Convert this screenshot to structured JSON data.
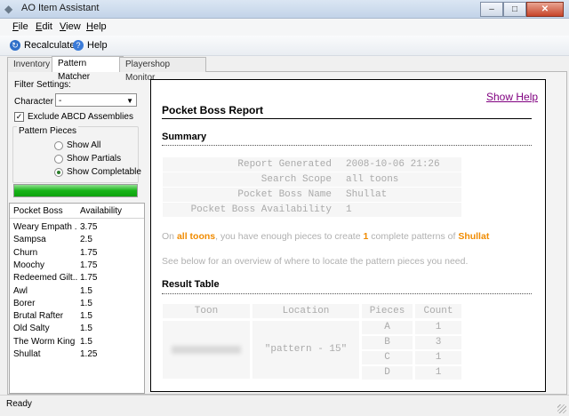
{
  "window": {
    "title": "AO Item Assistant",
    "controls": [
      "–",
      "□",
      "✕"
    ]
  },
  "menu": [
    {
      "key": "F",
      "rest": "ile"
    },
    {
      "key": "E",
      "rest": "dit"
    },
    {
      "key": "V",
      "rest": "iew"
    },
    {
      "key": "H",
      "rest": "elp"
    }
  ],
  "toolbar": {
    "recalculate_label": "Recalculate",
    "help_label": "Help"
  },
  "tabs": [
    {
      "label": "Inventory"
    },
    {
      "label": "Pattern Matcher"
    },
    {
      "label": "Playershop Monitor"
    }
  ],
  "filter": {
    "settings_label": "Filter Settings:",
    "character_label": "Character",
    "character_value": "-",
    "exclude_label": "Exclude ABCD Assemblies",
    "exclude_checked": true,
    "group_label": "Pattern Pieces",
    "radios": [
      {
        "label": "Show All",
        "selected": false
      },
      {
        "label": "Show Partials",
        "selected": false
      },
      {
        "label": "Show Completable",
        "selected": true
      }
    ],
    "progress_fraction": 1.0
  },
  "boss_list": {
    "headers": [
      "Pocket Boss",
      "Availability"
    ],
    "rows": [
      {
        "name": "Weary Empath ...",
        "avail": "3.75"
      },
      {
        "name": "Sampsa",
        "avail": "2.5"
      },
      {
        "name": "Churn",
        "avail": "1.75"
      },
      {
        "name": "Moochy",
        "avail": "1.75"
      },
      {
        "name": "Redeemed Gilt...",
        "avail": "1.75"
      },
      {
        "name": "Awl",
        "avail": "1.5"
      },
      {
        "name": "Borer",
        "avail": "1.5"
      },
      {
        "name": "Brutal Rafter",
        "avail": "1.5"
      },
      {
        "name": "Old Salty",
        "avail": "1.5"
      },
      {
        "name": "The Worm King",
        "avail": "1.5"
      },
      {
        "name": "Shullat",
        "avail": "1.25"
      }
    ]
  },
  "report": {
    "show_help": "Show Help",
    "title": "Pocket Boss Report",
    "summary_title": "Summary",
    "summary": [
      {
        "k": "Report Generated",
        "v": "2008-10-06 21:26"
      },
      {
        "k": "Search Scope",
        "v": "all toons"
      },
      {
        "k": "Pocket Boss Name",
        "v": "Shullat"
      },
      {
        "k": "Pocket Boss Availability",
        "v": "1"
      }
    ],
    "para1": {
      "t1": "On ",
      "scope": "all toons",
      "t2": ", you have enough pieces to create ",
      "count": "1",
      "t3": " complete patterns of ",
      "boss": "Shullat"
    },
    "para2": "See below for an overview of where to locate the pattern pieces you need.",
    "result_title": "Result Table",
    "result_headers": [
      "Toon",
      "Location",
      "Pieces",
      "Count"
    ],
    "result_toon": "",
    "result_location": "\"pattern - 15\"",
    "result_rows": [
      {
        "piece": "A",
        "count": "1"
      },
      {
        "piece": "B",
        "count": "3"
      },
      {
        "piece": "C",
        "count": "1"
      },
      {
        "piece": "D",
        "count": "1"
      }
    ]
  },
  "status": {
    "text": "Ready"
  },
  "colors": {
    "highlight": "#f08b00",
    "link": "#800080",
    "progress": "#18b418"
  }
}
